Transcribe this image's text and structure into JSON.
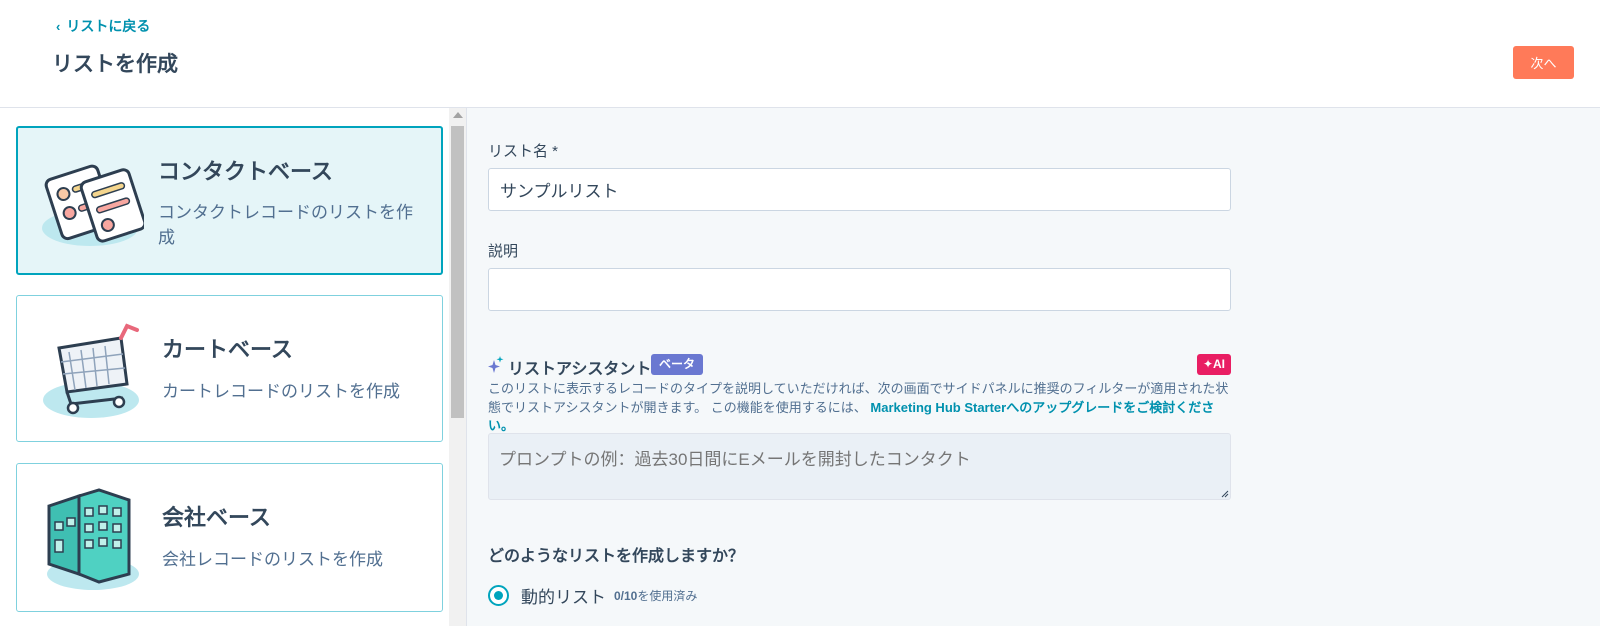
{
  "header": {
    "back_label": "リストに戻る",
    "title": "リストを作成",
    "next_label": "次へ"
  },
  "list_types": [
    {
      "title": "コンタクトベース",
      "description": "コンタクトレコードのリストを作成",
      "icon": "contact-card-icon",
      "selected": true
    },
    {
      "title": "カートベース",
      "description": "カートレコードのリストを作成",
      "icon": "shopping-cart-icon",
      "selected": false
    },
    {
      "title": "会社ベース",
      "description": "会社レコードのリストを作成",
      "icon": "building-icon",
      "selected": false
    }
  ],
  "form": {
    "name_label": "リスト名 *",
    "name_value": "サンプルリスト",
    "description_label": "説明",
    "description_value": "",
    "assistant": {
      "title": "リストアシスタント",
      "beta_badge": "ベータ",
      "ai_badge": "✦AI",
      "description": "このリストに表示するレコードのタイプを説明していただければ、次の画面でサイドパネルに推奨のフィルターが適用された状態でリストアシスタントが開きます。 この機能を使用するには、",
      "upgrade_link": "Marketing Hub Starterへのアップグレードをご検討ください。",
      "prompt_placeholder": "プロンプトの例：過去30日間にEメールを開封したコンタクト"
    },
    "list_kind_question": "どのようなリストを作成しますか？",
    "dynamic_option": {
      "label": "動的リスト",
      "usage_count": "0/10",
      "usage_suffix": "を使用済み",
      "selected": true
    }
  },
  "colors": {
    "accent": "#00a4bd",
    "primary_button": "#ff7a59",
    "link": "#0091ae",
    "beta": "#6a78d1",
    "ai": "#e91e63"
  }
}
